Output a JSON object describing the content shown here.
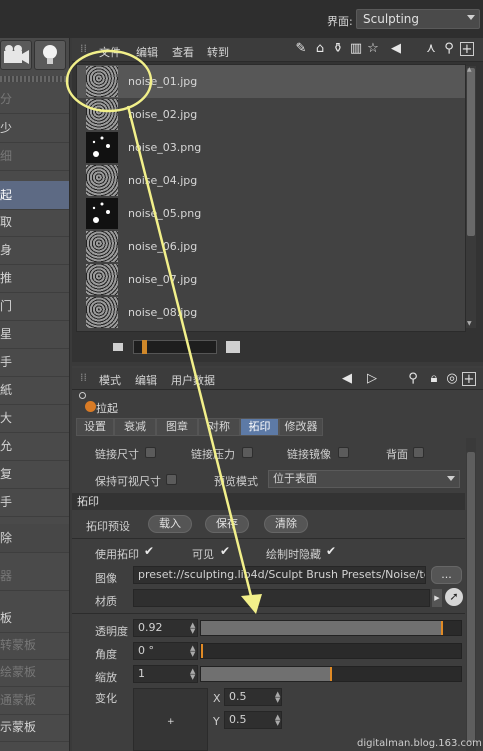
{
  "topbar": {
    "layout_label": "界面:",
    "layout_value": "Sculpting"
  },
  "left_panel": {
    "items": [
      "分",
      "少",
      "细",
      "起",
      "取",
      "身",
      "推",
      "门",
      "星",
      "手",
      "紙",
      "大",
      "允",
      "复",
      "手",
      "除",
      "器",
      "板",
      "转蒙板",
      "绘蒙板",
      "通蒙板",
      "示蒙板"
    ]
  },
  "browser": {
    "menu": {
      "file": "文件",
      "edit": "编辑",
      "view": "查看",
      "goto": "转到"
    },
    "files": [
      {
        "name": "noise_01.jpg",
        "selected": true
      },
      {
        "name": "noise_02.jpg",
        "selected": false
      },
      {
        "name": "noise_03.png",
        "selected": false
      },
      {
        "name": "noise_04.jpg",
        "selected": false
      },
      {
        "name": "noise_05.png",
        "selected": false
      },
      {
        "name": "noise_06.jpg",
        "selected": false
      },
      {
        "name": "noise_07.jpg",
        "selected": false
      },
      {
        "name": "noise_08.jpg",
        "selected": false
      }
    ]
  },
  "attr": {
    "menu": {
      "mode": "模式",
      "edit": "编辑",
      "userdata": "用户数据"
    },
    "tool_title": "拉起",
    "tabs": [
      "设置",
      "衰减",
      "图章",
      "对称",
      "拓印",
      "修改器"
    ],
    "active_tab": "拓印",
    "checks": {
      "link_size": "链接尺寸",
      "link_pressure": "链接压力",
      "link_mirror": "链接镜像",
      "backface": "背面",
      "keep_visible_size": "保持可视尺寸",
      "preview_mode_label": "预览模式",
      "preview_mode_value": "位于表面"
    },
    "section": "拓印",
    "preset_label": "拓印预设",
    "buttons": {
      "load": "载入",
      "save": "保存",
      "clear": "清除"
    },
    "use_stencil": "使用拓印",
    "visible": "可见",
    "hide_when_painting": "绘制时隐藏",
    "image_label": "图像",
    "image_value": "preset://sculpting.lib4d/Sculpt Brush Presets/Noise/te",
    "image_btn": "...",
    "material_label": "材质",
    "opacity_label": "透明度",
    "opacity_value": "0.92",
    "angle_label": "角度",
    "angle_value": "0 °",
    "scale_label": "缩放",
    "scale_value": "1",
    "transform_label": "变化",
    "x_label": "X",
    "x_value": "0.5",
    "y_label": "Y",
    "y_value": "0.5"
  },
  "watermark": "digitalman.blog.163.com",
  "colors": {
    "accent_orange": "#d97b25",
    "highlight_yellow": "#f2f08a",
    "selected_blue": "#5d7aa6"
  }
}
